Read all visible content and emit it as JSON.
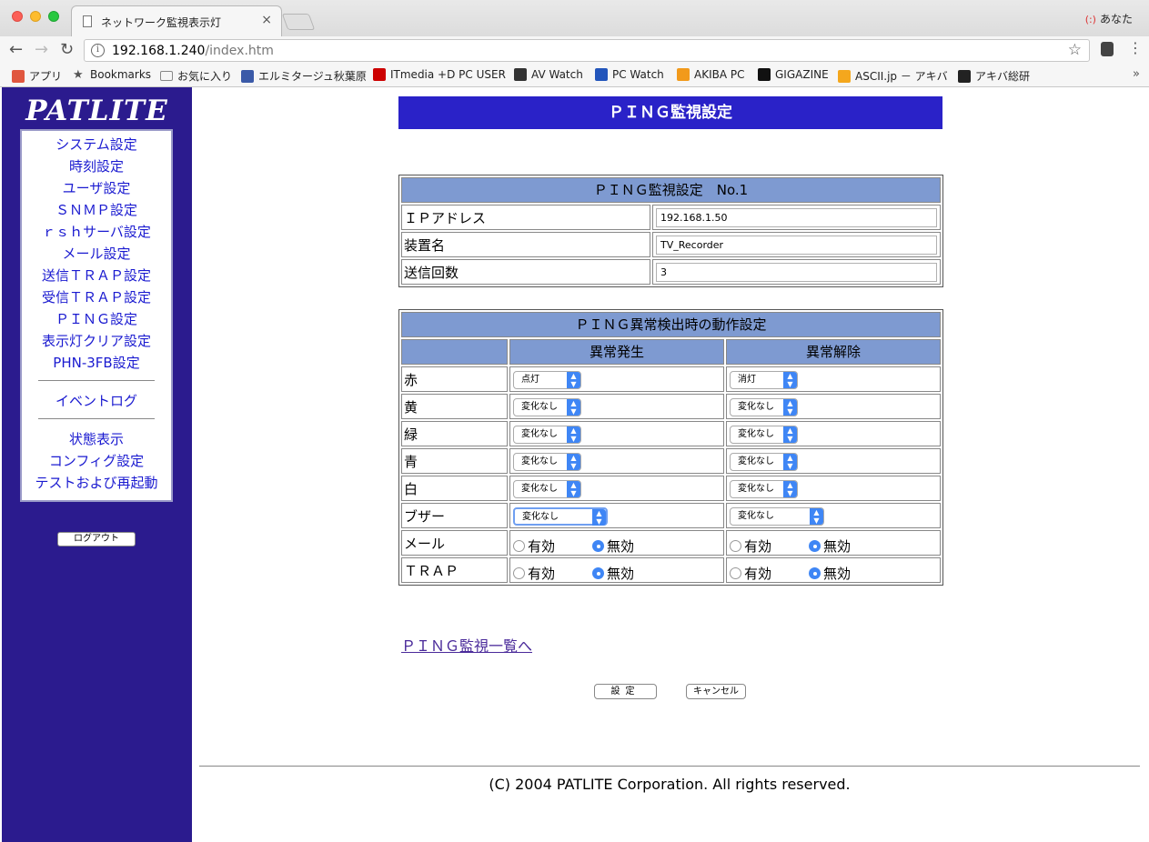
{
  "browser": {
    "tab_title": "ネットワーク監視表示灯",
    "tab_close": "×",
    "profile_name": "あなた",
    "url_host": "192.168.1.240",
    "url_path": "/index.htm",
    "bookmarks": [
      {
        "label": "アプリ",
        "icon": "apps-grid-icon",
        "color": "#e0573f"
      },
      {
        "label": "Bookmarks",
        "icon": "star-icon",
        "color": "#555555"
      },
      {
        "label": "お気に入り",
        "icon": "folder-icon",
        "color": "#888888"
      },
      {
        "label": "エルミタージュ秋葉原",
        "icon": "elm-icon",
        "color": "#3b5aa8"
      },
      {
        "label": "ITmedia +D PC USER",
        "icon": "itmedia-icon",
        "color": "#cc0000"
      },
      {
        "label": "AV Watch",
        "icon": "avwatch-icon",
        "color": "#333333"
      },
      {
        "label": "PC Watch",
        "icon": "pcwatch-icon",
        "color": "#2255bb"
      },
      {
        "label": "AKIBA PC",
        "icon": "akiba-icon",
        "color": "#f29a1b"
      },
      {
        "label": "GIGAZINE",
        "icon": "gigazine-icon",
        "color": "#111111"
      },
      {
        "label": "ASCII.jp － アキバ",
        "icon": "ascii-icon",
        "color": "#f4a71d"
      },
      {
        "label": "アキバ総研",
        "icon": "akiba-souken-icon",
        "color": "#222222"
      }
    ],
    "bookmarks_more": "»"
  },
  "sidebar": {
    "logo": "PATLITE",
    "menu_group1": [
      "システム設定",
      "時刻設定",
      "ユーザ設定",
      "ＳＮＭＰ設定",
      "ｒｓｈサーバ設定",
      "メール設定",
      "送信ＴＲＡＰ設定",
      "受信ＴＲＡＰ設定",
      "ＰＩＮＧ設定",
      "表示灯クリア設定",
      "PHN-3FB設定"
    ],
    "menu_group2": [
      "イベントログ"
    ],
    "menu_group3": [
      "状態表示",
      "コンフィグ設定",
      "テストおよび再起動"
    ],
    "logout": "ログアウト"
  },
  "main": {
    "title": "ＰＩＮＧ監視設定",
    "settings": {
      "header": "ＰＩＮＧ監視設定　No.1",
      "rows": [
        {
          "label": "ＩＰアドレス",
          "value": "192.168.1.50"
        },
        {
          "label": "装置名",
          "value": "TV_Recorder"
        },
        {
          "label": "送信回数",
          "value": "3"
        }
      ]
    },
    "action": {
      "header": "ＰＩＮＧ異常検出時の動作設定",
      "col_occur": "異常発生",
      "col_clear": "異常解除",
      "lamp_rows": [
        {
          "label": "赤",
          "occur": "点灯",
          "clear": "消灯"
        },
        {
          "label": "黄",
          "occur": "変化なし",
          "clear": "変化なし"
        },
        {
          "label": "緑",
          "occur": "変化なし",
          "clear": "変化なし"
        },
        {
          "label": "青",
          "occur": "変化なし",
          "clear": "変化なし"
        },
        {
          "label": "白",
          "occur": "変化なし",
          "clear": "変化なし"
        },
        {
          "label": "ブザー",
          "occur": "変化なし",
          "clear": "変化なし"
        }
      ],
      "radio_rows": [
        {
          "label": "メール",
          "occur": "無効",
          "clear": "無効"
        },
        {
          "label": "ＴＲＡＰ",
          "occur": "無効",
          "clear": "無効"
        }
      ],
      "radio_on": "有効",
      "radio_off": "無効"
    },
    "list_link": "ＰＩＮＧ監視一覧へ",
    "btn_set": "設定",
    "btn_cancel": "キャンセル",
    "footer": "(C) 2004 PATLITE Corporation. All rights reserved."
  }
}
